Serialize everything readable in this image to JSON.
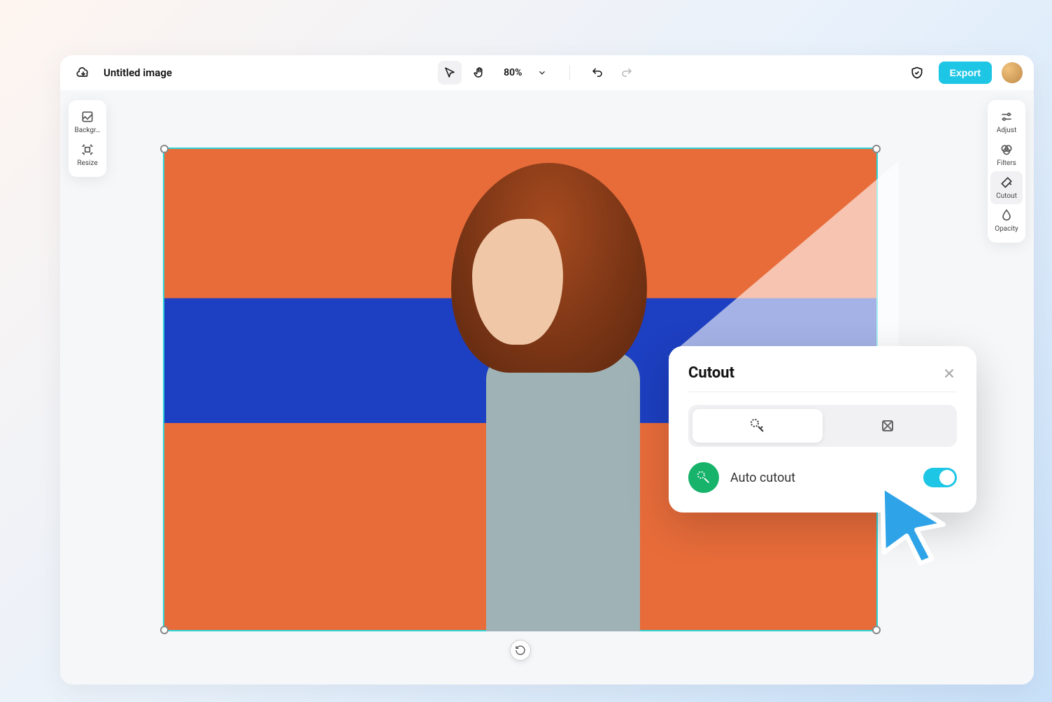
{
  "header": {
    "title": "Untitled image",
    "zoom_label": "80%",
    "export_label": "Export"
  },
  "left_tools": {
    "background_label": "Backgr…",
    "resize_label": "Resize"
  },
  "right_tools": {
    "adjust_label": "Adjust",
    "filters_label": "Filters",
    "cutout_label": "Cutout",
    "opacity_label": "Opacity"
  },
  "cutout_panel": {
    "title": "Cutout",
    "auto_cutout_label": "Auto cutout",
    "auto_cutout_enabled": true
  },
  "colors": {
    "accent": "#1ec6e6",
    "selection": "#2bd6d9",
    "success": "#17b36a"
  }
}
